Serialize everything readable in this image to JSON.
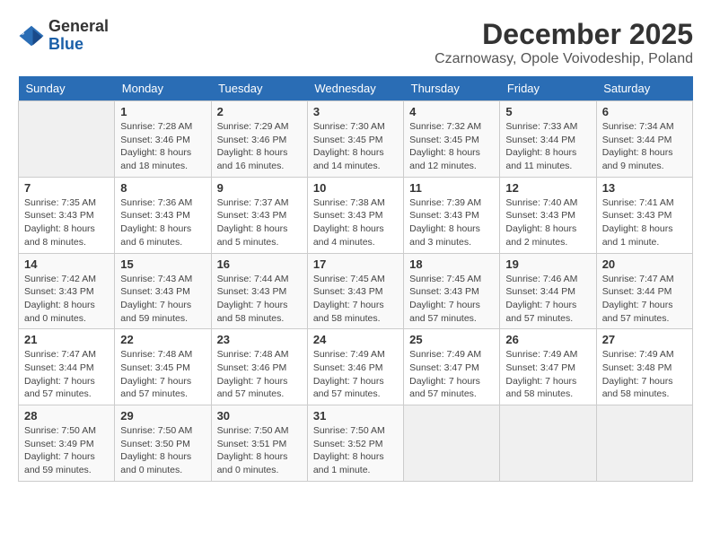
{
  "header": {
    "logo_general": "General",
    "logo_blue": "Blue",
    "month_title": "December 2025",
    "subtitle": "Czarnowasy, Opole Voivodeship, Poland"
  },
  "days_of_week": [
    "Sunday",
    "Monday",
    "Tuesday",
    "Wednesday",
    "Thursday",
    "Friday",
    "Saturday"
  ],
  "weeks": [
    [
      {
        "day": "",
        "info": ""
      },
      {
        "day": "1",
        "info": "Sunrise: 7:28 AM\nSunset: 3:46 PM\nDaylight: 8 hours\nand 18 minutes."
      },
      {
        "day": "2",
        "info": "Sunrise: 7:29 AM\nSunset: 3:46 PM\nDaylight: 8 hours\nand 16 minutes."
      },
      {
        "day": "3",
        "info": "Sunrise: 7:30 AM\nSunset: 3:45 PM\nDaylight: 8 hours\nand 14 minutes."
      },
      {
        "day": "4",
        "info": "Sunrise: 7:32 AM\nSunset: 3:45 PM\nDaylight: 8 hours\nand 12 minutes."
      },
      {
        "day": "5",
        "info": "Sunrise: 7:33 AM\nSunset: 3:44 PM\nDaylight: 8 hours\nand 11 minutes."
      },
      {
        "day": "6",
        "info": "Sunrise: 7:34 AM\nSunset: 3:44 PM\nDaylight: 8 hours\nand 9 minutes."
      }
    ],
    [
      {
        "day": "7",
        "info": "Sunrise: 7:35 AM\nSunset: 3:43 PM\nDaylight: 8 hours\nand 8 minutes."
      },
      {
        "day": "8",
        "info": "Sunrise: 7:36 AM\nSunset: 3:43 PM\nDaylight: 8 hours\nand 6 minutes."
      },
      {
        "day": "9",
        "info": "Sunrise: 7:37 AM\nSunset: 3:43 PM\nDaylight: 8 hours\nand 5 minutes."
      },
      {
        "day": "10",
        "info": "Sunrise: 7:38 AM\nSunset: 3:43 PM\nDaylight: 8 hours\nand 4 minutes."
      },
      {
        "day": "11",
        "info": "Sunrise: 7:39 AM\nSunset: 3:43 PM\nDaylight: 8 hours\nand 3 minutes."
      },
      {
        "day": "12",
        "info": "Sunrise: 7:40 AM\nSunset: 3:43 PM\nDaylight: 8 hours\nand 2 minutes."
      },
      {
        "day": "13",
        "info": "Sunrise: 7:41 AM\nSunset: 3:43 PM\nDaylight: 8 hours\nand 1 minute."
      }
    ],
    [
      {
        "day": "14",
        "info": "Sunrise: 7:42 AM\nSunset: 3:43 PM\nDaylight: 8 hours\nand 0 minutes."
      },
      {
        "day": "15",
        "info": "Sunrise: 7:43 AM\nSunset: 3:43 PM\nDaylight: 7 hours\nand 59 minutes."
      },
      {
        "day": "16",
        "info": "Sunrise: 7:44 AM\nSunset: 3:43 PM\nDaylight: 7 hours\nand 58 minutes."
      },
      {
        "day": "17",
        "info": "Sunrise: 7:45 AM\nSunset: 3:43 PM\nDaylight: 7 hours\nand 58 minutes."
      },
      {
        "day": "18",
        "info": "Sunrise: 7:45 AM\nSunset: 3:43 PM\nDaylight: 7 hours\nand 57 minutes."
      },
      {
        "day": "19",
        "info": "Sunrise: 7:46 AM\nSunset: 3:44 PM\nDaylight: 7 hours\nand 57 minutes."
      },
      {
        "day": "20",
        "info": "Sunrise: 7:47 AM\nSunset: 3:44 PM\nDaylight: 7 hours\nand 57 minutes."
      }
    ],
    [
      {
        "day": "21",
        "info": "Sunrise: 7:47 AM\nSunset: 3:44 PM\nDaylight: 7 hours\nand 57 minutes."
      },
      {
        "day": "22",
        "info": "Sunrise: 7:48 AM\nSunset: 3:45 PM\nDaylight: 7 hours\nand 57 minutes."
      },
      {
        "day": "23",
        "info": "Sunrise: 7:48 AM\nSunset: 3:46 PM\nDaylight: 7 hours\nand 57 minutes."
      },
      {
        "day": "24",
        "info": "Sunrise: 7:49 AM\nSunset: 3:46 PM\nDaylight: 7 hours\nand 57 minutes."
      },
      {
        "day": "25",
        "info": "Sunrise: 7:49 AM\nSunset: 3:47 PM\nDaylight: 7 hours\nand 57 minutes."
      },
      {
        "day": "26",
        "info": "Sunrise: 7:49 AM\nSunset: 3:47 PM\nDaylight: 7 hours\nand 58 minutes."
      },
      {
        "day": "27",
        "info": "Sunrise: 7:49 AM\nSunset: 3:48 PM\nDaylight: 7 hours\nand 58 minutes."
      }
    ],
    [
      {
        "day": "28",
        "info": "Sunrise: 7:50 AM\nSunset: 3:49 PM\nDaylight: 7 hours\nand 59 minutes."
      },
      {
        "day": "29",
        "info": "Sunrise: 7:50 AM\nSunset: 3:50 PM\nDaylight: 8 hours\nand 0 minutes."
      },
      {
        "day": "30",
        "info": "Sunrise: 7:50 AM\nSunset: 3:51 PM\nDaylight: 8 hours\nand 0 minutes."
      },
      {
        "day": "31",
        "info": "Sunrise: 7:50 AM\nSunset: 3:52 PM\nDaylight: 8 hours\nand 1 minute."
      },
      {
        "day": "",
        "info": ""
      },
      {
        "day": "",
        "info": ""
      },
      {
        "day": "",
        "info": ""
      }
    ]
  ]
}
